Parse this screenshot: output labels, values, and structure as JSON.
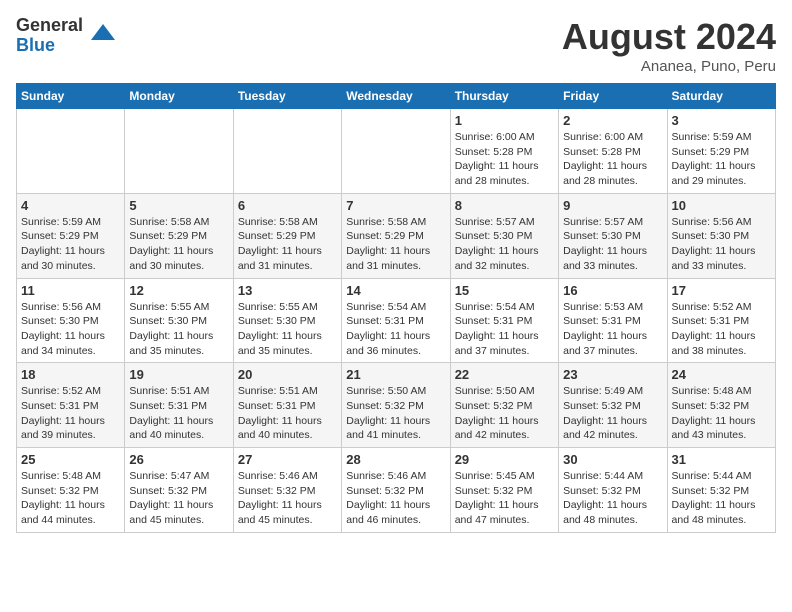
{
  "header": {
    "logo_general": "General",
    "logo_blue": "Blue",
    "month_title": "August 2024",
    "location": "Ananea, Puno, Peru"
  },
  "weekdays": [
    "Sunday",
    "Monday",
    "Tuesday",
    "Wednesday",
    "Thursday",
    "Friday",
    "Saturday"
  ],
  "weeks": [
    [
      {
        "day": "",
        "info": ""
      },
      {
        "day": "",
        "info": ""
      },
      {
        "day": "",
        "info": ""
      },
      {
        "day": "",
        "info": ""
      },
      {
        "day": "1",
        "info": "Sunrise: 6:00 AM\nSunset: 5:28 PM\nDaylight: 11 hours\nand 28 minutes."
      },
      {
        "day": "2",
        "info": "Sunrise: 6:00 AM\nSunset: 5:28 PM\nDaylight: 11 hours\nand 28 minutes."
      },
      {
        "day": "3",
        "info": "Sunrise: 5:59 AM\nSunset: 5:29 PM\nDaylight: 11 hours\nand 29 minutes."
      }
    ],
    [
      {
        "day": "4",
        "info": "Sunrise: 5:59 AM\nSunset: 5:29 PM\nDaylight: 11 hours\nand 30 minutes."
      },
      {
        "day": "5",
        "info": "Sunrise: 5:58 AM\nSunset: 5:29 PM\nDaylight: 11 hours\nand 30 minutes."
      },
      {
        "day": "6",
        "info": "Sunrise: 5:58 AM\nSunset: 5:29 PM\nDaylight: 11 hours\nand 31 minutes."
      },
      {
        "day": "7",
        "info": "Sunrise: 5:58 AM\nSunset: 5:29 PM\nDaylight: 11 hours\nand 31 minutes."
      },
      {
        "day": "8",
        "info": "Sunrise: 5:57 AM\nSunset: 5:30 PM\nDaylight: 11 hours\nand 32 minutes."
      },
      {
        "day": "9",
        "info": "Sunrise: 5:57 AM\nSunset: 5:30 PM\nDaylight: 11 hours\nand 33 minutes."
      },
      {
        "day": "10",
        "info": "Sunrise: 5:56 AM\nSunset: 5:30 PM\nDaylight: 11 hours\nand 33 minutes."
      }
    ],
    [
      {
        "day": "11",
        "info": "Sunrise: 5:56 AM\nSunset: 5:30 PM\nDaylight: 11 hours\nand 34 minutes."
      },
      {
        "day": "12",
        "info": "Sunrise: 5:55 AM\nSunset: 5:30 PM\nDaylight: 11 hours\nand 35 minutes."
      },
      {
        "day": "13",
        "info": "Sunrise: 5:55 AM\nSunset: 5:30 PM\nDaylight: 11 hours\nand 35 minutes."
      },
      {
        "day": "14",
        "info": "Sunrise: 5:54 AM\nSunset: 5:31 PM\nDaylight: 11 hours\nand 36 minutes."
      },
      {
        "day": "15",
        "info": "Sunrise: 5:54 AM\nSunset: 5:31 PM\nDaylight: 11 hours\nand 37 minutes."
      },
      {
        "day": "16",
        "info": "Sunrise: 5:53 AM\nSunset: 5:31 PM\nDaylight: 11 hours\nand 37 minutes."
      },
      {
        "day": "17",
        "info": "Sunrise: 5:52 AM\nSunset: 5:31 PM\nDaylight: 11 hours\nand 38 minutes."
      }
    ],
    [
      {
        "day": "18",
        "info": "Sunrise: 5:52 AM\nSunset: 5:31 PM\nDaylight: 11 hours\nand 39 minutes."
      },
      {
        "day": "19",
        "info": "Sunrise: 5:51 AM\nSunset: 5:31 PM\nDaylight: 11 hours\nand 40 minutes."
      },
      {
        "day": "20",
        "info": "Sunrise: 5:51 AM\nSunset: 5:31 PM\nDaylight: 11 hours\nand 40 minutes."
      },
      {
        "day": "21",
        "info": "Sunrise: 5:50 AM\nSunset: 5:32 PM\nDaylight: 11 hours\nand 41 minutes."
      },
      {
        "day": "22",
        "info": "Sunrise: 5:50 AM\nSunset: 5:32 PM\nDaylight: 11 hours\nand 42 minutes."
      },
      {
        "day": "23",
        "info": "Sunrise: 5:49 AM\nSunset: 5:32 PM\nDaylight: 11 hours\nand 42 minutes."
      },
      {
        "day": "24",
        "info": "Sunrise: 5:48 AM\nSunset: 5:32 PM\nDaylight: 11 hours\nand 43 minutes."
      }
    ],
    [
      {
        "day": "25",
        "info": "Sunrise: 5:48 AM\nSunset: 5:32 PM\nDaylight: 11 hours\nand 44 minutes."
      },
      {
        "day": "26",
        "info": "Sunrise: 5:47 AM\nSunset: 5:32 PM\nDaylight: 11 hours\nand 45 minutes."
      },
      {
        "day": "27",
        "info": "Sunrise: 5:46 AM\nSunset: 5:32 PM\nDaylight: 11 hours\nand 45 minutes."
      },
      {
        "day": "28",
        "info": "Sunrise: 5:46 AM\nSunset: 5:32 PM\nDaylight: 11 hours\nand 46 minutes."
      },
      {
        "day": "29",
        "info": "Sunrise: 5:45 AM\nSunset: 5:32 PM\nDaylight: 11 hours\nand 47 minutes."
      },
      {
        "day": "30",
        "info": "Sunrise: 5:44 AM\nSunset: 5:32 PM\nDaylight: 11 hours\nand 48 minutes."
      },
      {
        "day": "31",
        "info": "Sunrise: 5:44 AM\nSunset: 5:32 PM\nDaylight: 11 hours\nand 48 minutes."
      }
    ]
  ]
}
